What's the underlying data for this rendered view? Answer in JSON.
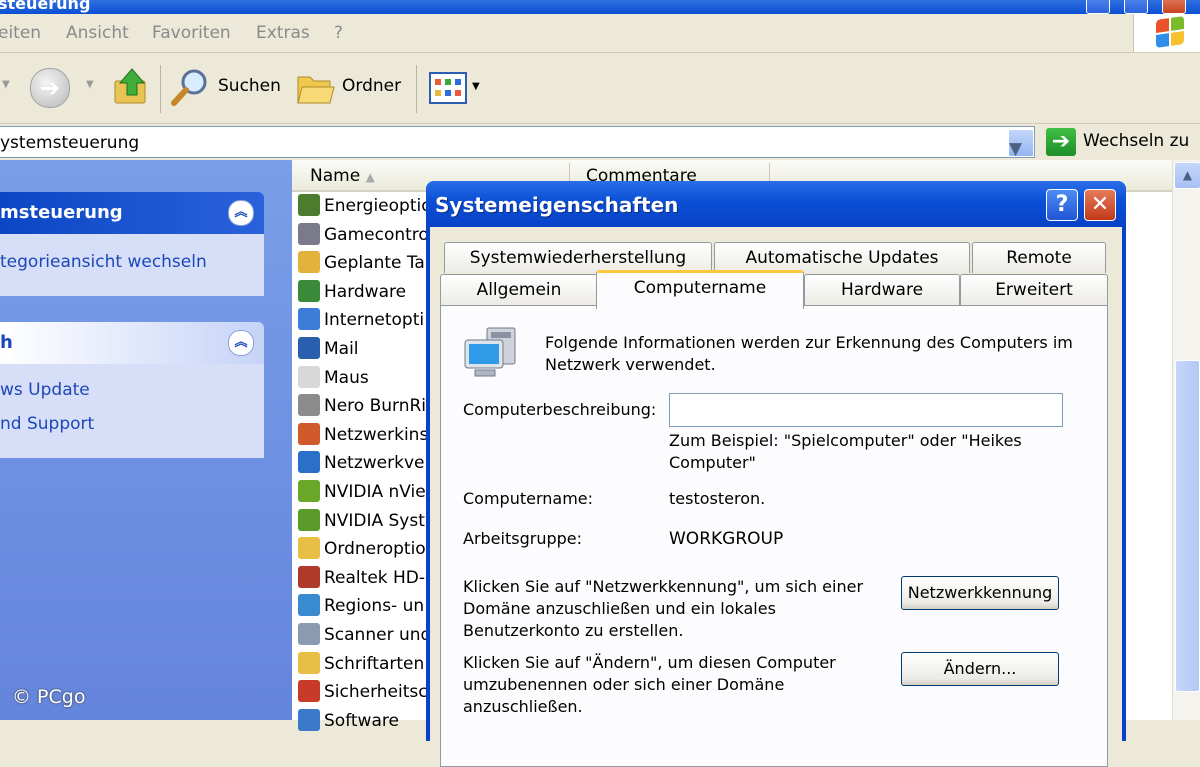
{
  "window": {
    "title": "steuerung"
  },
  "menu": [
    "eiten",
    "Ansicht",
    "Favoriten",
    "Extras",
    "?"
  ],
  "toolbar": {
    "search_label": "Suchen",
    "folder_label": "Ordner"
  },
  "address": {
    "value": "ystemsteuerung",
    "go_label": "Wechseln zu"
  },
  "left_panel": {
    "panel1": {
      "title": "msteuerung",
      "link": "tegorieansicht wechseln"
    },
    "panel2": {
      "title": "h",
      "links": [
        "ws Update",
        "nd Support"
      ]
    }
  },
  "columns": {
    "name": "Name",
    "comments": "Commentare"
  },
  "files": [
    {
      "label": "Energieoptio",
      "icon": "power-options-icon",
      "color": "#4d7c2f"
    },
    {
      "label": "Gamecontro",
      "icon": "game-controller-icon",
      "color": "#7a7a8a"
    },
    {
      "label": "Geplante Ta",
      "icon": "scheduled-tasks-icon",
      "color": "#e2b33c"
    },
    {
      "label": "Hardware",
      "icon": "hardware-icon",
      "color": "#3a8a3a"
    },
    {
      "label": "Internetopti",
      "icon": "internet-options-icon",
      "color": "#3b7dd8"
    },
    {
      "label": "Mail",
      "icon": "mail-icon",
      "color": "#2a5fb0"
    },
    {
      "label": "Maus",
      "icon": "mouse-icon",
      "color": "#d8d8d8"
    },
    {
      "label": "Nero BurnRi",
      "icon": "nero-icon",
      "color": "#8c8c8c"
    },
    {
      "label": "Netzwerkins",
      "icon": "network-setup-icon",
      "color": "#d05a2a"
    },
    {
      "label": "Netzwerkve",
      "icon": "network-connections-icon",
      "color": "#2a6fc9"
    },
    {
      "label": "NVIDIA nVie",
      "icon": "nvidia-view-icon",
      "color": "#6aa82a"
    },
    {
      "label": "NVIDIA Syst",
      "icon": "nvidia-system-icon",
      "color": "#5a9a2a"
    },
    {
      "label": "Ordneroptio",
      "icon": "folder-options-icon",
      "color": "#e8bf45"
    },
    {
      "label": "Realtek HD-",
      "icon": "realtek-icon",
      "color": "#b03a2a"
    },
    {
      "label": "Regions- un",
      "icon": "regional-options-icon",
      "color": "#3a8ad0"
    },
    {
      "label": "Scanner und",
      "icon": "scanner-icon",
      "color": "#8a9ab0"
    },
    {
      "label": "Schriftarten",
      "icon": "fonts-icon",
      "color": "#e8bf45"
    },
    {
      "label": "Sicherheitsc",
      "icon": "security-center-icon",
      "color": "#c83a2a"
    },
    {
      "label": "Software",
      "icon": "software-icon",
      "color": "#3a7ac8"
    }
  ],
  "watermark": "© PCgo",
  "dialog": {
    "title": "Systemeigenschaften",
    "help_label": "?",
    "tabs_row1": [
      "Systemwiederherstellung",
      "Automatische Updates",
      "Remote"
    ],
    "tabs_row2": [
      "Allgemein",
      "Computername",
      "Hardware",
      "Erweitert"
    ],
    "intro": "Folgende Informationen werden zur Erkennung des Computers im Netzwerk verwendet.",
    "desc_label": "Computerbeschreibung:",
    "desc_value": "",
    "example": "Zum Beispiel: \"Spielcomputer\" oder \"Heikes Computer\"",
    "computername_label": "Computername:",
    "computername_value": "testosteron.",
    "workgroup_label": "Arbeitsgruppe:",
    "workgroup_value": "WORKGROUP",
    "network_text": "Klicken Sie auf \"Netzwerkkennung\", um sich einer Domäne anzuschließen und ein lokales Benutzerkonto zu erstellen.",
    "network_button": "Netzwerkkennung",
    "change_text": "Klicken Sie auf \"Ändern\", um diesen Computer umzubenennen oder sich einer Domäne anzuschließen.",
    "change_button": "Ändern..."
  }
}
